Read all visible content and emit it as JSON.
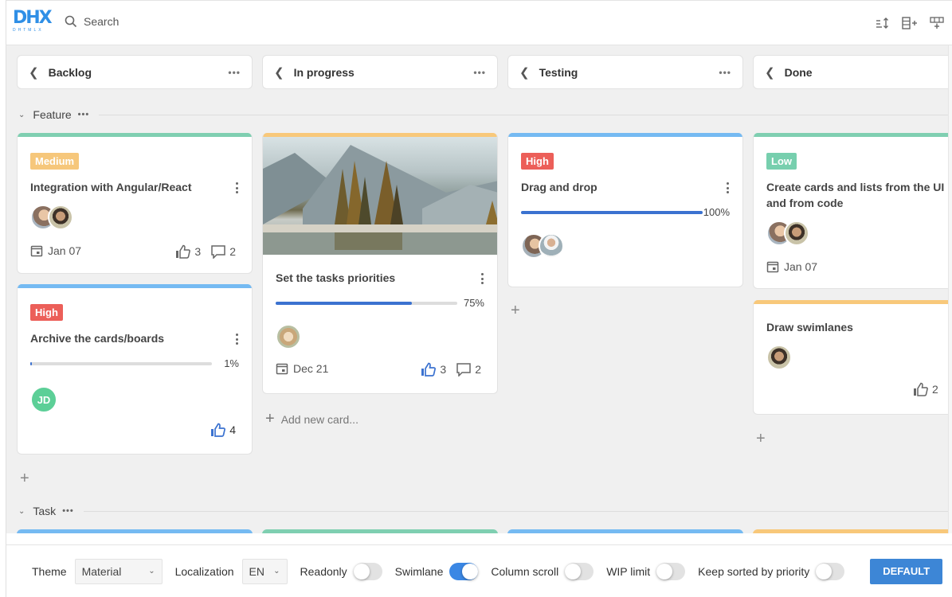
{
  "topbar": {
    "logo_text": "DHX",
    "logo_subtext": "DHTMLX",
    "search_placeholder": "Search",
    "icons": [
      "sort-icon",
      "add-column-icon",
      "add-row-icon"
    ]
  },
  "columns": [
    {
      "label": "Backlog"
    },
    {
      "label": "In progress"
    },
    {
      "label": "Testing"
    },
    {
      "label": "Done"
    }
  ],
  "lanes": [
    {
      "label": "Feature"
    },
    {
      "label": "Task"
    }
  ],
  "colors": {
    "green": "#7fcfb1",
    "blue": "#75baf2",
    "orange": "#f8c87a",
    "tag_medium": "#f6c77b",
    "tag_high": "#ec5f59",
    "tag_low": "#77cfae",
    "progress": "#3b72d0",
    "like_active": "#3b72d0",
    "accent": "#3d86d6"
  },
  "cards": {
    "backlog_1": {
      "priority": "Medium",
      "title": "Integration with Angular/React",
      "date": "Jan 07",
      "likes": "3",
      "comments": "2"
    },
    "backlog_2": {
      "priority": "High",
      "title": "Archive the cards/boards",
      "progress": 1,
      "progress_label": "1%",
      "assignee_initials": "JD",
      "likes": "4"
    },
    "inprogress_1": {
      "title": "Set the tasks priorities",
      "progress": 75,
      "progress_label": "75%",
      "date": "Dec 21",
      "likes": "3",
      "comments": "2",
      "image": "mountain-lake-photo"
    },
    "testing_1": {
      "priority": "High",
      "title": "Drag and drop",
      "progress": 100,
      "progress_label": "100%"
    },
    "done_1": {
      "priority": "Low",
      "title": "Create cards and lists from the UI and from code",
      "date": "Jan 07"
    },
    "done_2": {
      "title": "Draw swimlanes",
      "likes": "2"
    }
  },
  "add_new_card_label": "Add new card...",
  "footer": {
    "theme_label": "Theme",
    "theme_value": "Material",
    "localization_label": "Localization",
    "localization_value": "EN",
    "toggles": [
      {
        "label": "Readonly",
        "on": false
      },
      {
        "label": "Swimlane",
        "on": true
      },
      {
        "label": "Column scroll",
        "on": false
      },
      {
        "label": "WIP limit",
        "on": false
      },
      {
        "label": "Keep sorted by priority",
        "on": false
      }
    ],
    "default_button": "DEFAULT"
  }
}
